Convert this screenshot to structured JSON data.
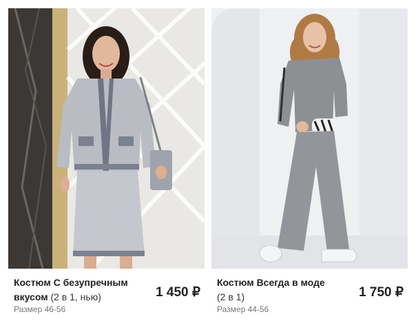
{
  "products": [
    {
      "title_main": "Костюм С безупречным вкусом",
      "title_sub": "(2 в 1, нью)",
      "price": "1 450 ₽",
      "size": "Размер 46-56",
      "image_alt": "Woman in grey tweed skirt suit"
    },
    {
      "title_main": "Костюм Всегда в моде",
      "title_sub": "(2 в 1)",
      "price": "1 750 ₽",
      "size": "Размер 44-56",
      "image_alt": "Woman in grey knit sweater and wide trousers"
    }
  ],
  "colors": {
    "suit_grey": "#b9bcc3",
    "knit_grey": "#8e8f93",
    "background_light": "#eef0f2"
  }
}
